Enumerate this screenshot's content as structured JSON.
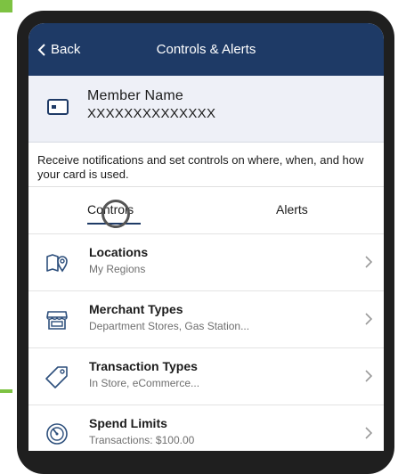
{
  "header": {
    "back_label": "Back",
    "title": "Controls & Alerts"
  },
  "member": {
    "name": "Member Name",
    "number": "XXXXXXXXXXXXXX"
  },
  "description": "Receive notifications and set controls on where, when, and how your card is used.",
  "tabs": [
    {
      "label": "Controls",
      "selected": true
    },
    {
      "label": "Alerts",
      "selected": false
    }
  ],
  "items": [
    {
      "title": "Locations",
      "subtitle": "My Regions",
      "icon": "map-pin-icon"
    },
    {
      "title": "Merchant Types",
      "subtitle": "Department Stores, Gas Station...",
      "icon": "storefront-icon"
    },
    {
      "title": "Transaction Types",
      "subtitle": "In Store, eCommerce...",
      "icon": "tag-icon"
    },
    {
      "title": "Spend Limits",
      "subtitle": "Transactions: $100.00",
      "icon": "gauge-icon"
    }
  ],
  "colors": {
    "header_bg": "#1e3a66",
    "member_bg": "#eef0f7",
    "accent": "#7dc242",
    "icon": "#2d4f7c"
  }
}
